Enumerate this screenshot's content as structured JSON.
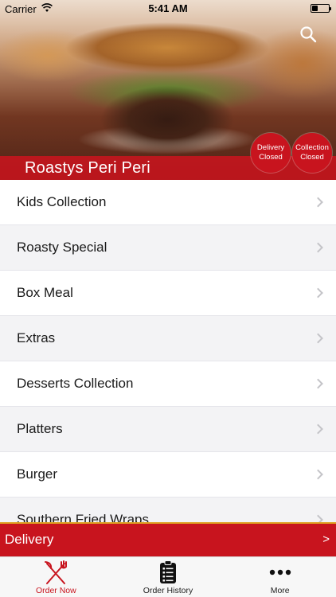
{
  "status_bar": {
    "carrier": "Carrier",
    "time": "5:41 AM"
  },
  "header": {
    "restaurant_name": "Roastys Peri Peri",
    "delivery_badge": {
      "line1": "Delivery",
      "line2": "Closed"
    },
    "collection_badge": {
      "line1": "Collection",
      "line2": "Closed"
    },
    "icons": {
      "search": "search-icon"
    }
  },
  "menu": {
    "items": [
      {
        "label": "Kids Collection"
      },
      {
        "label": "Roasty Special"
      },
      {
        "label": "Box Meal"
      },
      {
        "label": "Extras"
      },
      {
        "label": "Desserts Collection"
      },
      {
        "label": "Platters"
      },
      {
        "label": "Burger"
      },
      {
        "label": "Southern Fried Wraps"
      }
    ]
  },
  "delivery_bar": {
    "label": "Delivery",
    "arrow": ">"
  },
  "tabs": [
    {
      "label": "Order Now",
      "icon": "fork-knife-icon",
      "active": true
    },
    {
      "label": "Order History",
      "icon": "clipboard-icon",
      "active": false
    },
    {
      "label": "More",
      "icon": "more-dots-icon",
      "active": false
    }
  ],
  "colors": {
    "accent": "#c8141e",
    "stripe": "#e0a020"
  }
}
